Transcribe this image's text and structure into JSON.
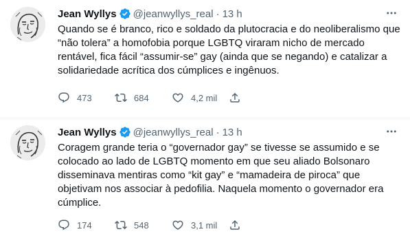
{
  "tweets": [
    {
      "author": {
        "name": "Jean Wyllys",
        "handle": "@jeanwyllys_real",
        "verified": true
      },
      "time": "13 h",
      "text": "Quando se é branco, rico e soldado da plutocracia e do neoliberalismo que “não tolera” a homofobia porque LGBTQ viraram nicho de mercado rentável, fica fácil “assumir-se” gay (ainda que se negando) e catalizar a solidariedade acrítica dos cúmplices e ingênuos.",
      "replies": "473",
      "retweets": "684",
      "likes": "4,2 mil"
    },
    {
      "author": {
        "name": "Jean Wyllys",
        "handle": "@jeanwyllys_real",
        "verified": true
      },
      "time": "13 h",
      "text": "Coragem grande teria o “governador gay” se tivesse se assumido e se colocado ao lado de LGBTQ momento em que seu aliado Bolsonaro disseminava mentiras como “kit gay” e “mamadeira de piroca” que objetivam nos associar à pedofilia. Naquela momento o governador era cúmplice.",
      "replies": "174",
      "retweets": "548",
      "likes": "3,1 mil"
    }
  ],
  "icons": {
    "verified": "verified-badge-icon",
    "more": "more-options-icon",
    "reply": "reply-icon",
    "retweet": "retweet-icon",
    "like": "heart-icon",
    "share": "share-icon"
  },
  "colors": {
    "text": "#0f1419",
    "secondary": "#536471",
    "verified": "#1d9bf0",
    "divider": "#eff3f4"
  }
}
